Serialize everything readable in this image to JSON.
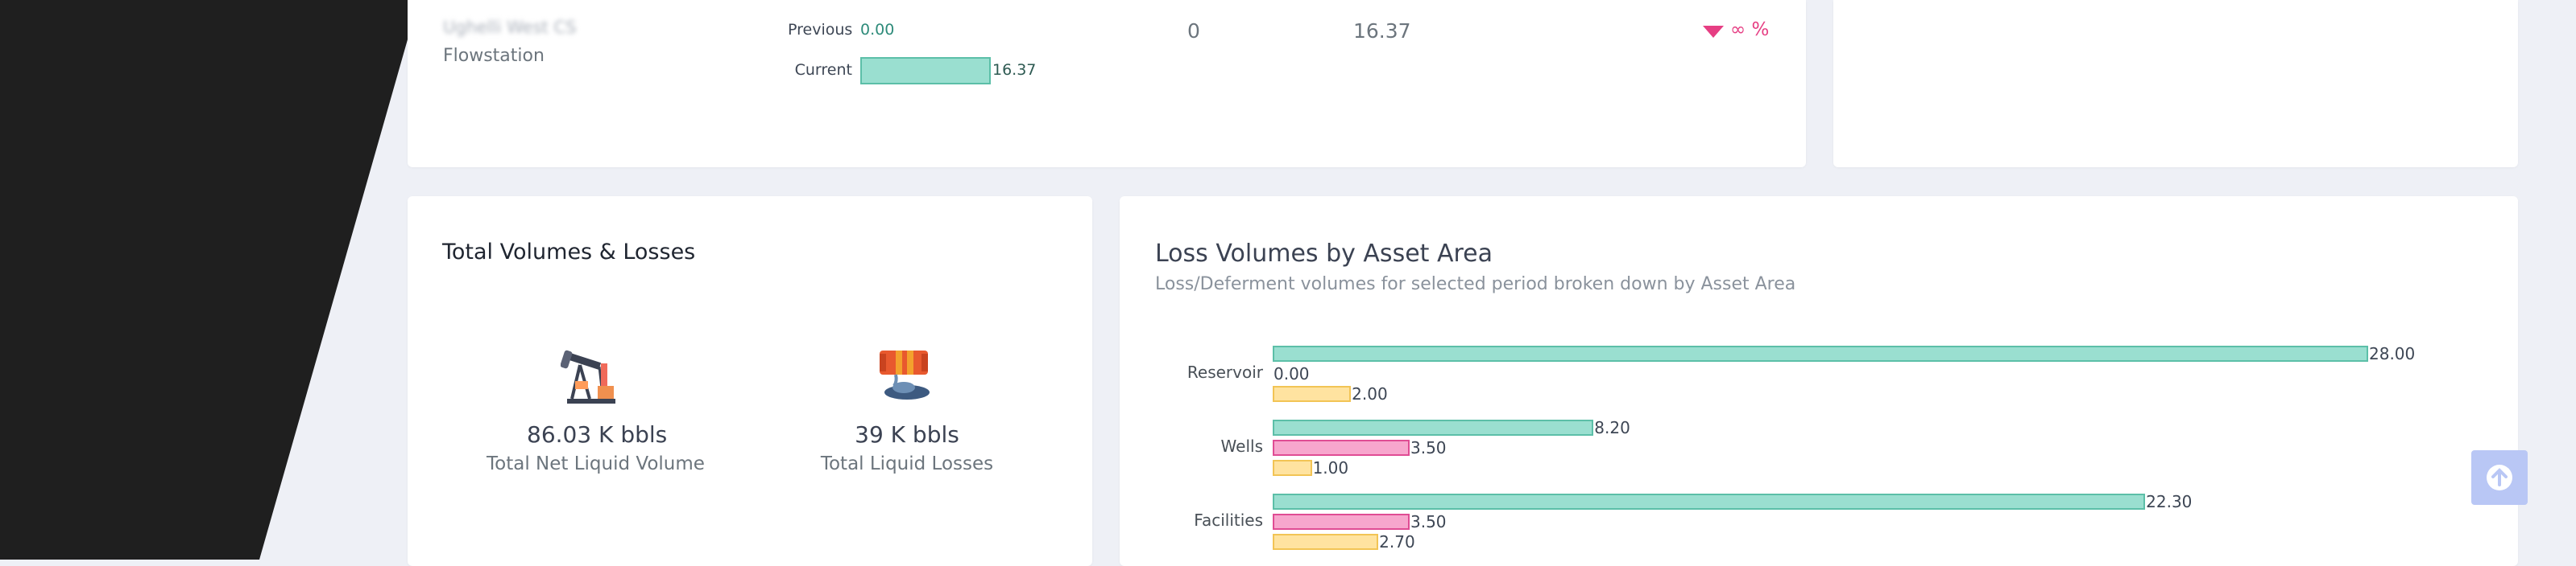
{
  "flowstation": {
    "name": "Ughelli West CS",
    "type": "Flowstation",
    "previous_label": "Previous",
    "previous_value": "0.00",
    "current_label": "Current",
    "current_value": "16.37",
    "col_zero": "0",
    "col_value": "16.37",
    "change": "∞ %",
    "down_color": "#e63e83"
  },
  "totals": {
    "title": "Total Volumes & Losses",
    "net_value": "86.03 K bbls",
    "net_label": "Total Net Liquid Volume",
    "loss_value": "39 K bbls",
    "loss_label": "Total Liquid Losses",
    "net_icon": "oil-pump-icon",
    "loss_icon": "leaking-pipe-icon"
  },
  "loss_chart": {
    "title": "Loss Volumes by Asset Area",
    "subtitle": "Loss/Deferment volumes for selected period broken down by Asset Area"
  },
  "chart_data": {
    "type": "bar",
    "orientation": "horizontal",
    "categories": [
      "Reservoir",
      "Wells",
      "Facilities"
    ],
    "series": [
      {
        "color": "#9adfd0",
        "values": [
          28.0,
          8.2,
          22.3
        ],
        "labels": [
          "28.00",
          "8.20",
          "22.30"
        ]
      },
      {
        "color": "#f7a6cd",
        "values": [
          0.0,
          3.5,
          3.5
        ],
        "labels": [
          "0.00",
          "3.50",
          "3.50"
        ]
      },
      {
        "color": "#ffe3a0",
        "values": [
          2.0,
          1.0,
          2.7
        ],
        "labels": [
          "2.00",
          "1.00",
          "2.70"
        ]
      }
    ]
  },
  "scroll_top_icon": "arrow-up-icon"
}
